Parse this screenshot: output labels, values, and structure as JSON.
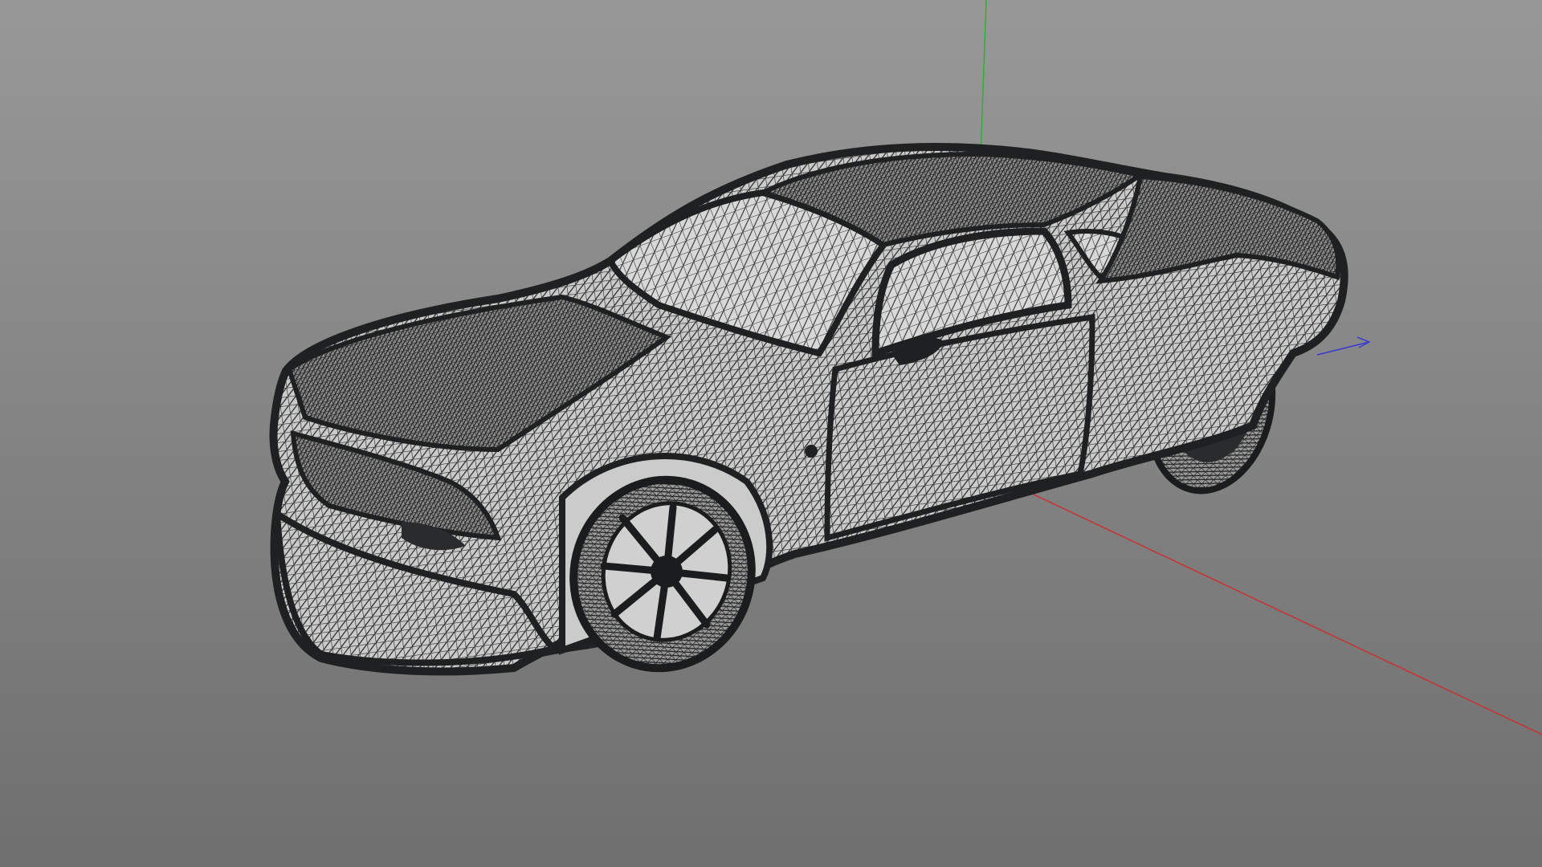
{
  "viewport": {
    "background_top": "#989898",
    "background_bottom": "#6f6f6f"
  },
  "axes": {
    "x_color": "#c83232",
    "y_color": "#2fb02f",
    "z_color": "#3a3ad0"
  },
  "model": {
    "display_mode": "wireframe",
    "object": "car",
    "mesh_color": "#2a2b2c",
    "surface_color": "#c9c9c9"
  }
}
